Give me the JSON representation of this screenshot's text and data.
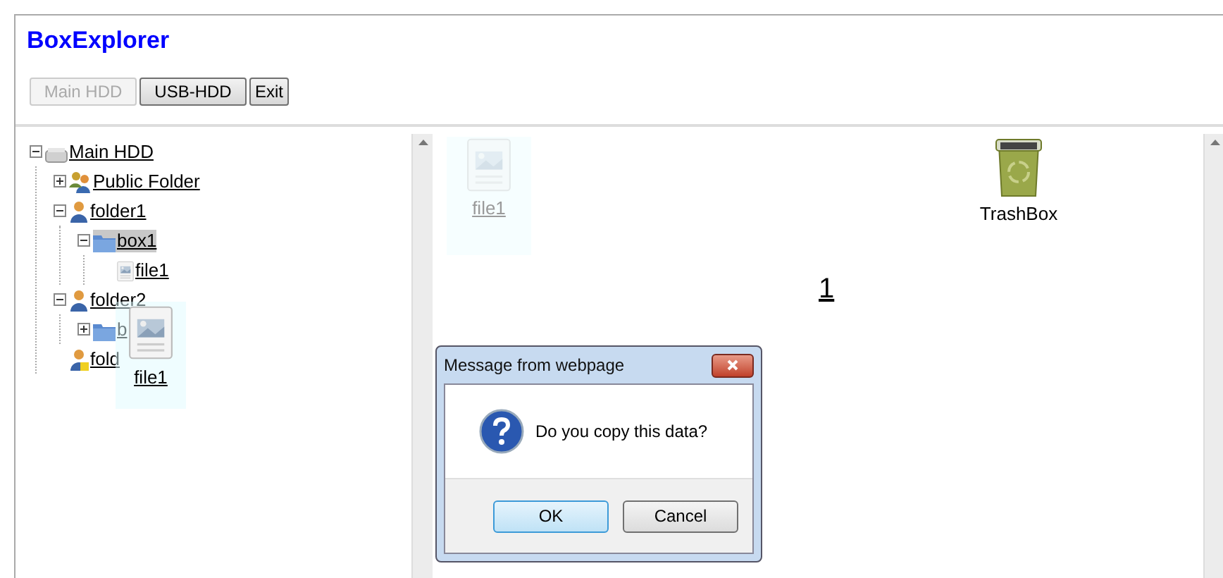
{
  "title": "BoxExplorer",
  "buttons": [
    {
      "label": "Main HDD",
      "disabled": true
    },
    {
      "label": "USB-HDD",
      "disabled": false
    },
    {
      "label": "Exit",
      "disabled": false
    }
  ],
  "tree": [
    {
      "label": "Main HDD",
      "kind": "drive",
      "expanded": true,
      "selected": false,
      "children": [
        {
          "label": "Public Folder",
          "kind": "shared",
          "expanded": false,
          "selected": false
        },
        {
          "label": "folder1",
          "kind": "user",
          "expanded": true,
          "selected": false,
          "children": [
            {
              "label": "box1",
              "kind": "box",
              "expanded": true,
              "selected": true,
              "children": [
                {
                  "label": "file1",
                  "kind": "file",
                  "selected": false
                }
              ]
            }
          ]
        },
        {
          "label": "folder2",
          "kind": "user",
          "expanded": true,
          "selected": false,
          "children": [
            {
              "label": "b",
              "kind": "box",
              "expanded": false,
              "selected": false
            }
          ]
        },
        {
          "label": "fold",
          "kind": "user_locked",
          "selected": false
        }
      ]
    }
  ],
  "drag_ghost": {
    "label": "file1"
  },
  "pane_items": [
    {
      "label": "file1",
      "kind": "file",
      "faded": true
    },
    {
      "label": "TrashBox",
      "kind": "trash",
      "faded": false
    }
  ],
  "page": "1",
  "dialog": {
    "title": "Message from webpage",
    "message": "Do you copy this data?",
    "buttons": [
      {
        "label": "OK",
        "default": true
      },
      {
        "label": "Cancel",
        "default": false
      }
    ]
  }
}
